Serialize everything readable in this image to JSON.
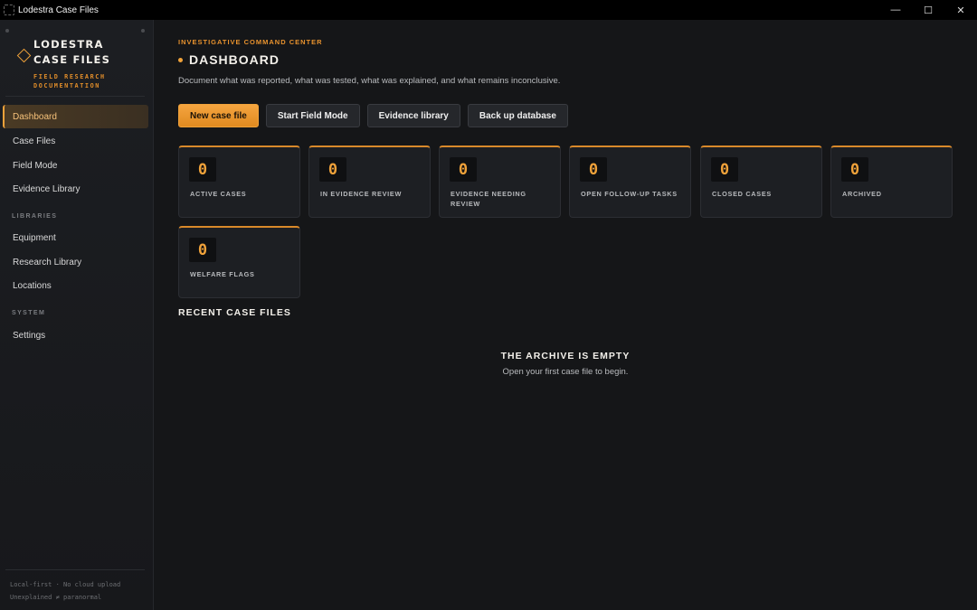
{
  "window": {
    "title": "Lodestra Case Files",
    "controls": {
      "minimize": "—",
      "maximize": "☐",
      "close": "✕"
    }
  },
  "brand": {
    "name_line1": "LODESTRA",
    "name_line2": "CASE FILES",
    "tag_line1": "FIELD RESEARCH",
    "tag_line2": "DOCUMENTATION",
    "accent_color": "#f0a23a"
  },
  "sidebar": {
    "items": [
      {
        "label": "Dashboard",
        "active": true
      },
      {
        "label": "Case Files"
      },
      {
        "label": "Field Mode"
      },
      {
        "label": "Evidence Library"
      }
    ],
    "libraries_label": "LIBRARIES",
    "libraries": [
      {
        "label": "Equipment"
      },
      {
        "label": "Research Library"
      },
      {
        "label": "Locations"
      }
    ],
    "system_label": "SYSTEM",
    "system": [
      {
        "label": "Settings"
      }
    ],
    "footer_line1": "Local-first · No cloud upload",
    "footer_line2": "Unexplained ≠ paranormal"
  },
  "header": {
    "eyebrow": "INVESTIGATIVE COMMAND CENTER",
    "title": "DASHBOARD",
    "subtitle": "Document what was reported, what was tested, what was explained, and what remains inconclusive."
  },
  "actions": {
    "new_case": "New case file",
    "field_mode": "Start Field Mode",
    "evidence_library": "Evidence library",
    "backup": "Back up database"
  },
  "stats": [
    {
      "value": "0",
      "label": "ACTIVE CASES"
    },
    {
      "value": "0",
      "label": "IN EVIDENCE REVIEW"
    },
    {
      "value": "0",
      "label": "EVIDENCE NEEDING REVIEW"
    },
    {
      "value": "0",
      "label": "OPEN FOLLOW-UP TASKS"
    },
    {
      "value": "0",
      "label": "CLOSED CASES"
    },
    {
      "value": "0",
      "label": "ARCHIVED"
    },
    {
      "value": "0",
      "label": "WELFARE FLAGS"
    }
  ],
  "recent": {
    "title": "RECENT CASE FILES",
    "empty_title": "THE ARCHIVE IS EMPTY",
    "empty_text": "Open your first case file to begin."
  }
}
